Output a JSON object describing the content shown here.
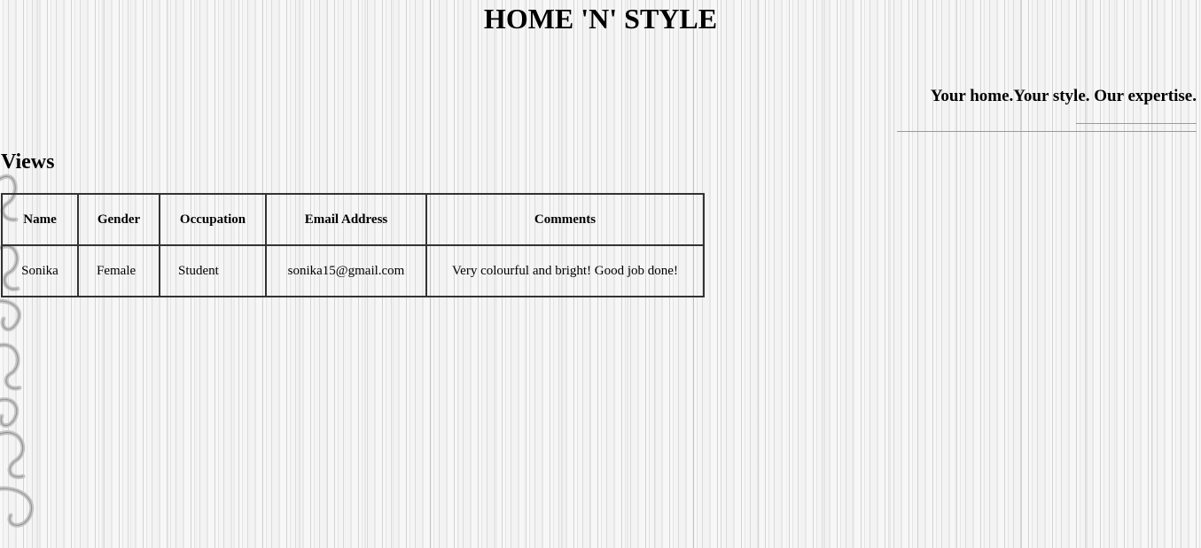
{
  "site": {
    "title": "HOME 'N' STYLE",
    "tagline": "Your home.Your style. Our expertise."
  },
  "section": {
    "title": "Views"
  },
  "table": {
    "headers": [
      "Name",
      "Gender",
      "Occupation",
      "Email Address",
      "Comments"
    ],
    "rows": [
      [
        "Sonika",
        "Female",
        "Student",
        "sonika15@gmail.com",
        "Very colourful and bright! Good job done!"
      ]
    ]
  },
  "decoration": {
    "icon": "swirl-ornament"
  }
}
